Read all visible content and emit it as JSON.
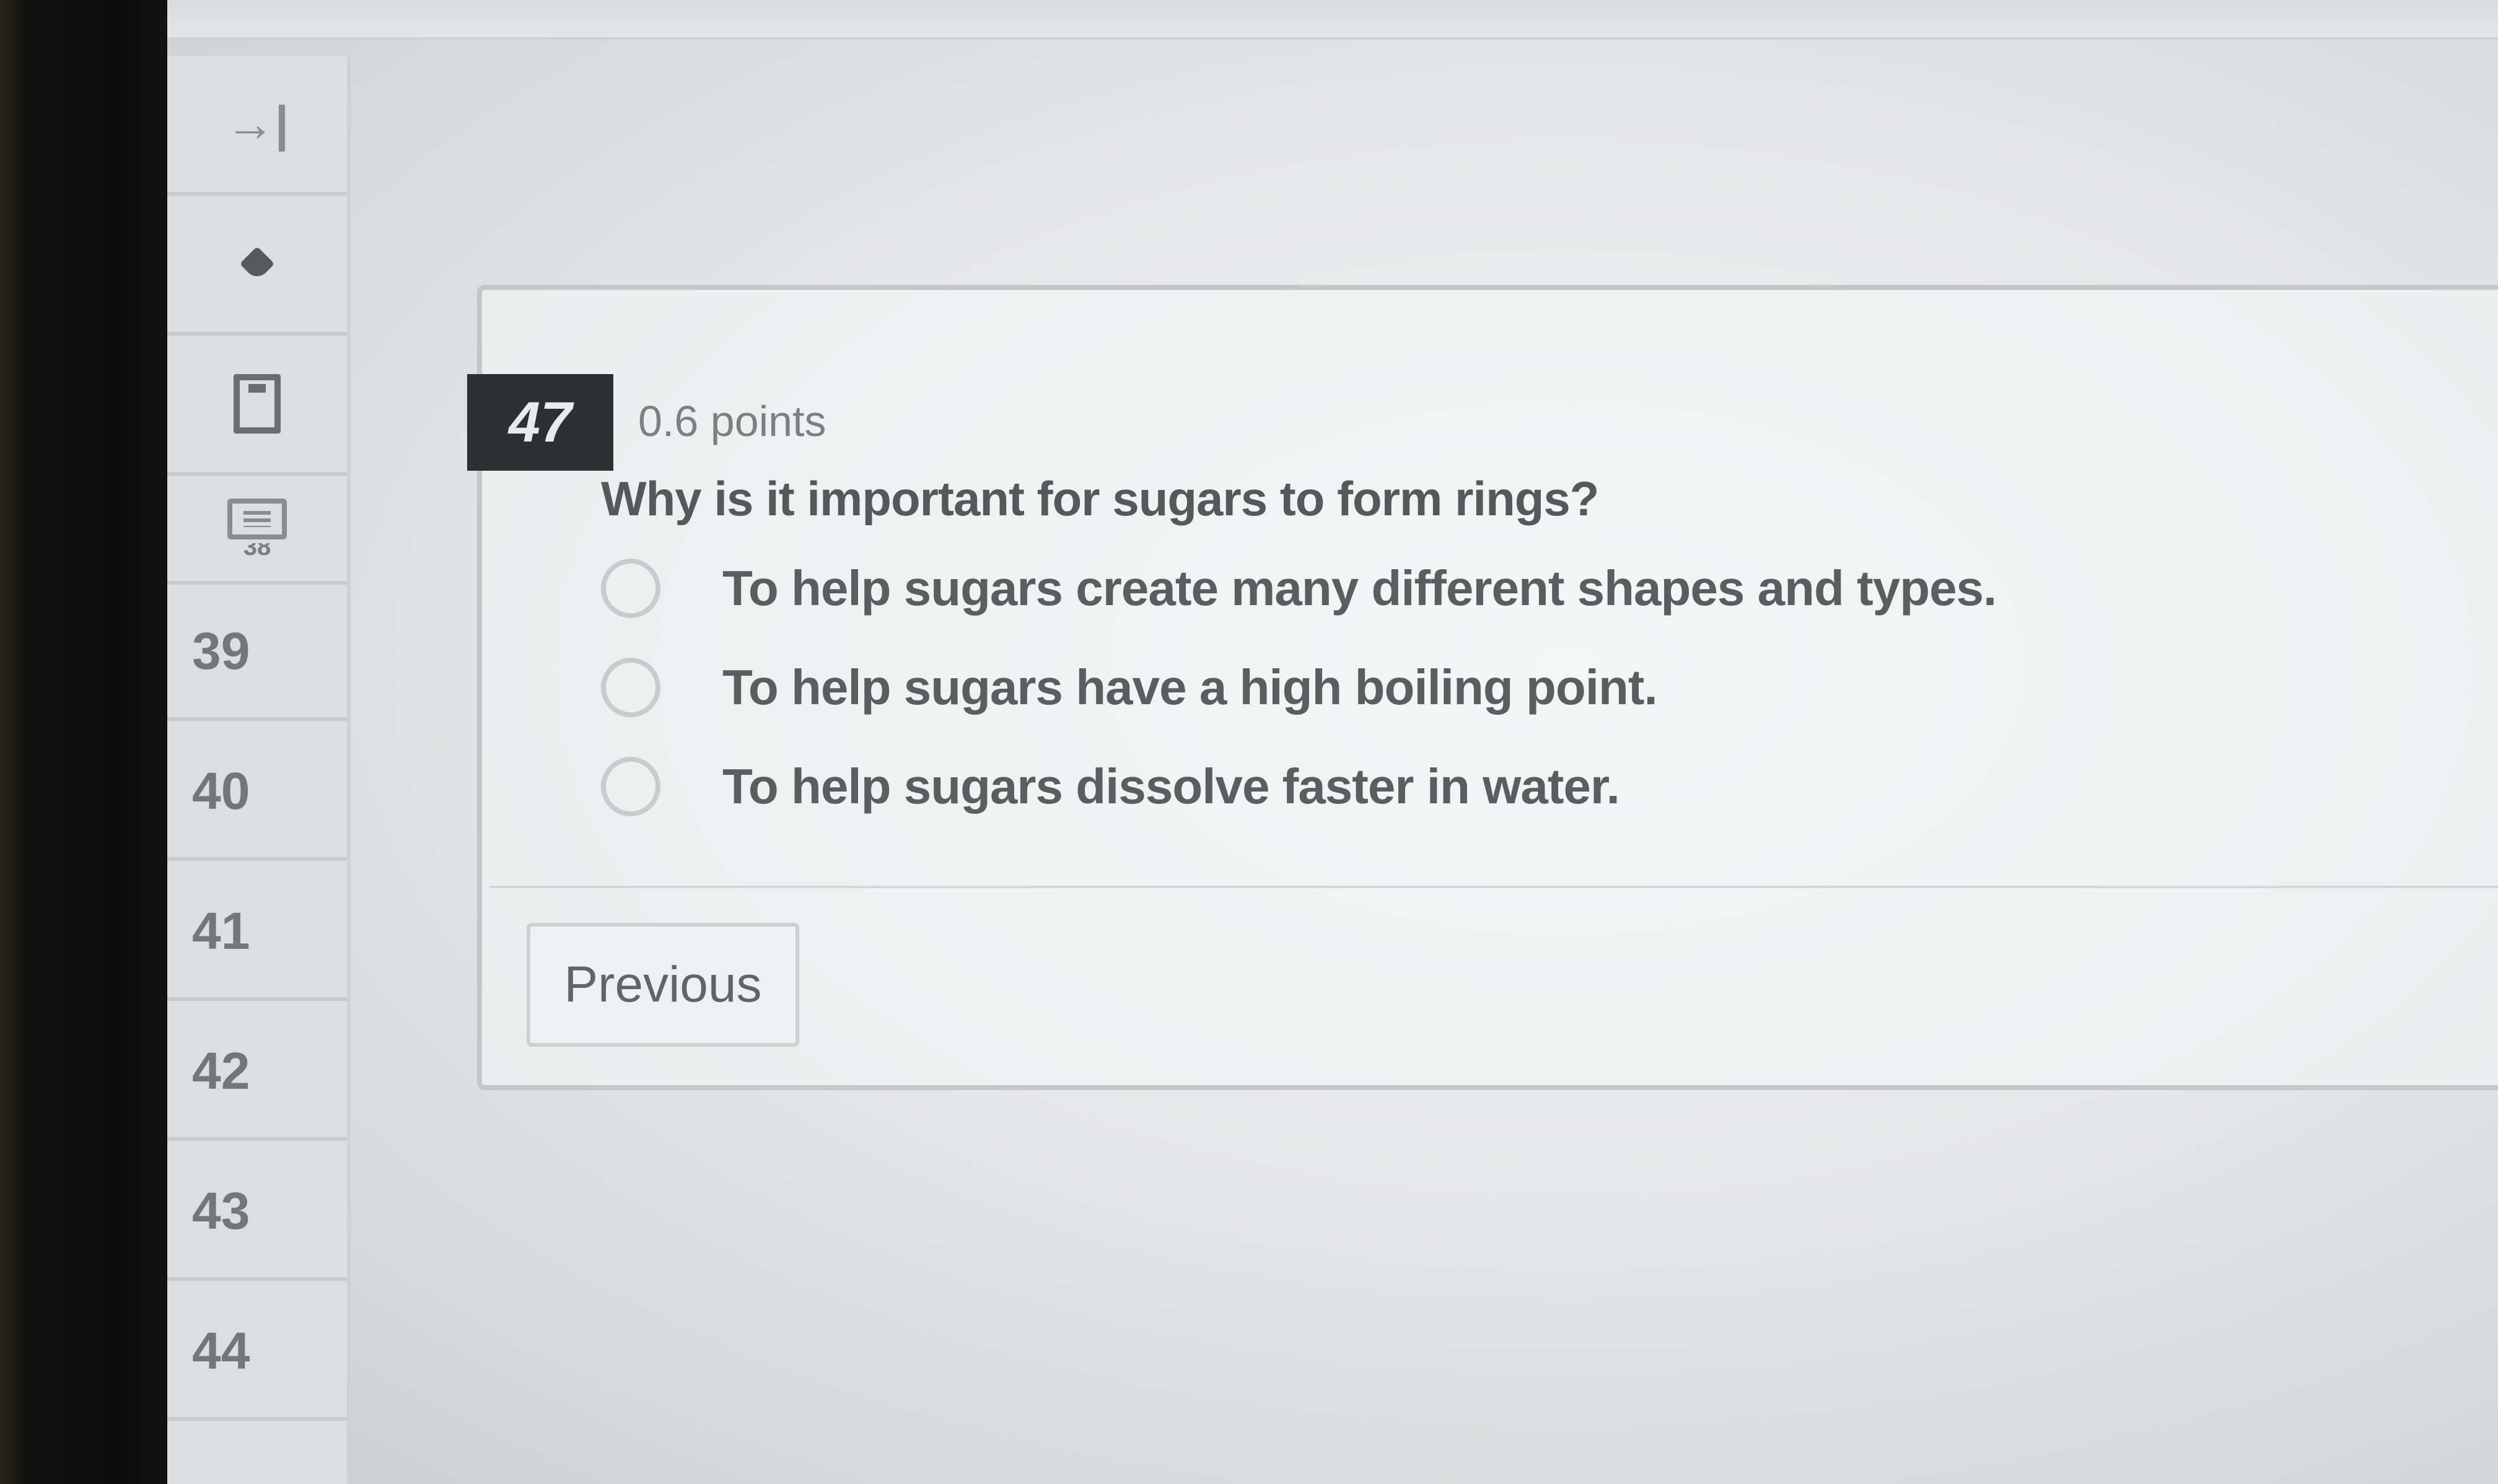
{
  "sidebar": {
    "partial_label": "38",
    "questions": [
      "39",
      "40",
      "41",
      "42",
      "43",
      "44"
    ]
  },
  "question": {
    "number": "47",
    "points": "0.6 points",
    "prompt": "Why is it important for sugars to form rings?",
    "options": [
      {
        "label": "To help sugars create many different shapes and types.",
        "selected": false
      },
      {
        "label": "To help sugars have a high boiling point.",
        "selected": false
      },
      {
        "label": "To help sugars dissolve faster in water.",
        "selected": false
      }
    ]
  },
  "nav": {
    "previous_label": "Previous"
  },
  "icons": {
    "expand": "collapse-expand-icon",
    "pin": "pin-icon",
    "save": "save-icon",
    "list": "list-icon"
  },
  "colors": {
    "question_number_bg": "#2d3033",
    "background": "#e6e7e8"
  }
}
